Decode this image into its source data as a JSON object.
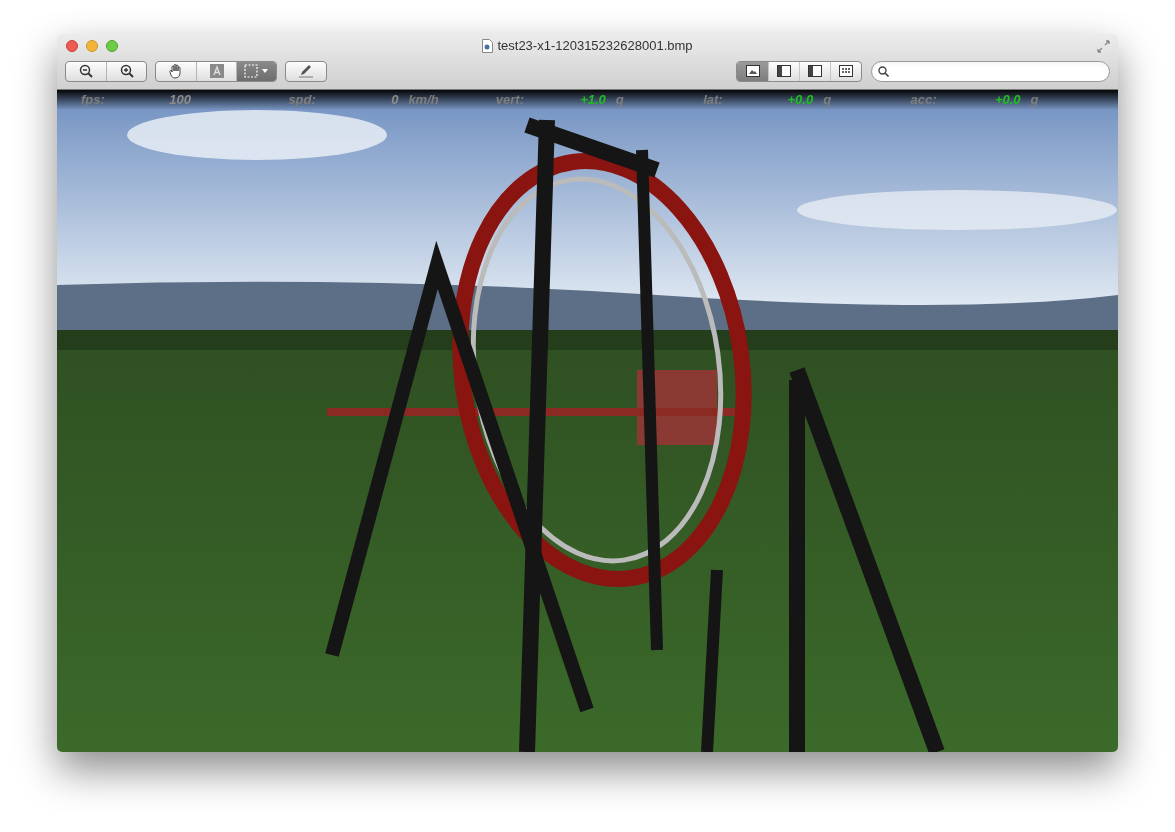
{
  "window": {
    "title": "test23-x1-120315232628001.bmp"
  },
  "tools": [
    {
      "kind": "zoom-out",
      "selected": false
    },
    {
      "kind": "zoom-in",
      "selected": false
    },
    {
      "kind": "hand",
      "selected": false
    },
    {
      "kind": "text",
      "selected": false
    },
    {
      "kind": "select",
      "selected": true
    },
    {
      "kind": "annotate",
      "selected": false
    }
  ],
  "view_buttons": [
    {
      "kind": "content",
      "selected": true
    },
    {
      "kind": "sidebar",
      "selected": false
    },
    {
      "kind": "sidebar",
      "selected": false
    },
    {
      "kind": "grid",
      "selected": false
    }
  ],
  "hud": [
    {
      "label": "fps:",
      "value": "100",
      "highlight": false
    },
    {
      "label": "spd:",
      "value": "0",
      "unit": "km/h",
      "highlight": false
    },
    {
      "label": "vert:",
      "value": "+1.0",
      "unit": "g",
      "highlight": true
    },
    {
      "label": "lat:",
      "value": "+0.0",
      "unit": "g",
      "highlight": true
    },
    {
      "label": "acc:",
      "value": "+0.0",
      "unit": "g",
      "highlight": true
    }
  ]
}
